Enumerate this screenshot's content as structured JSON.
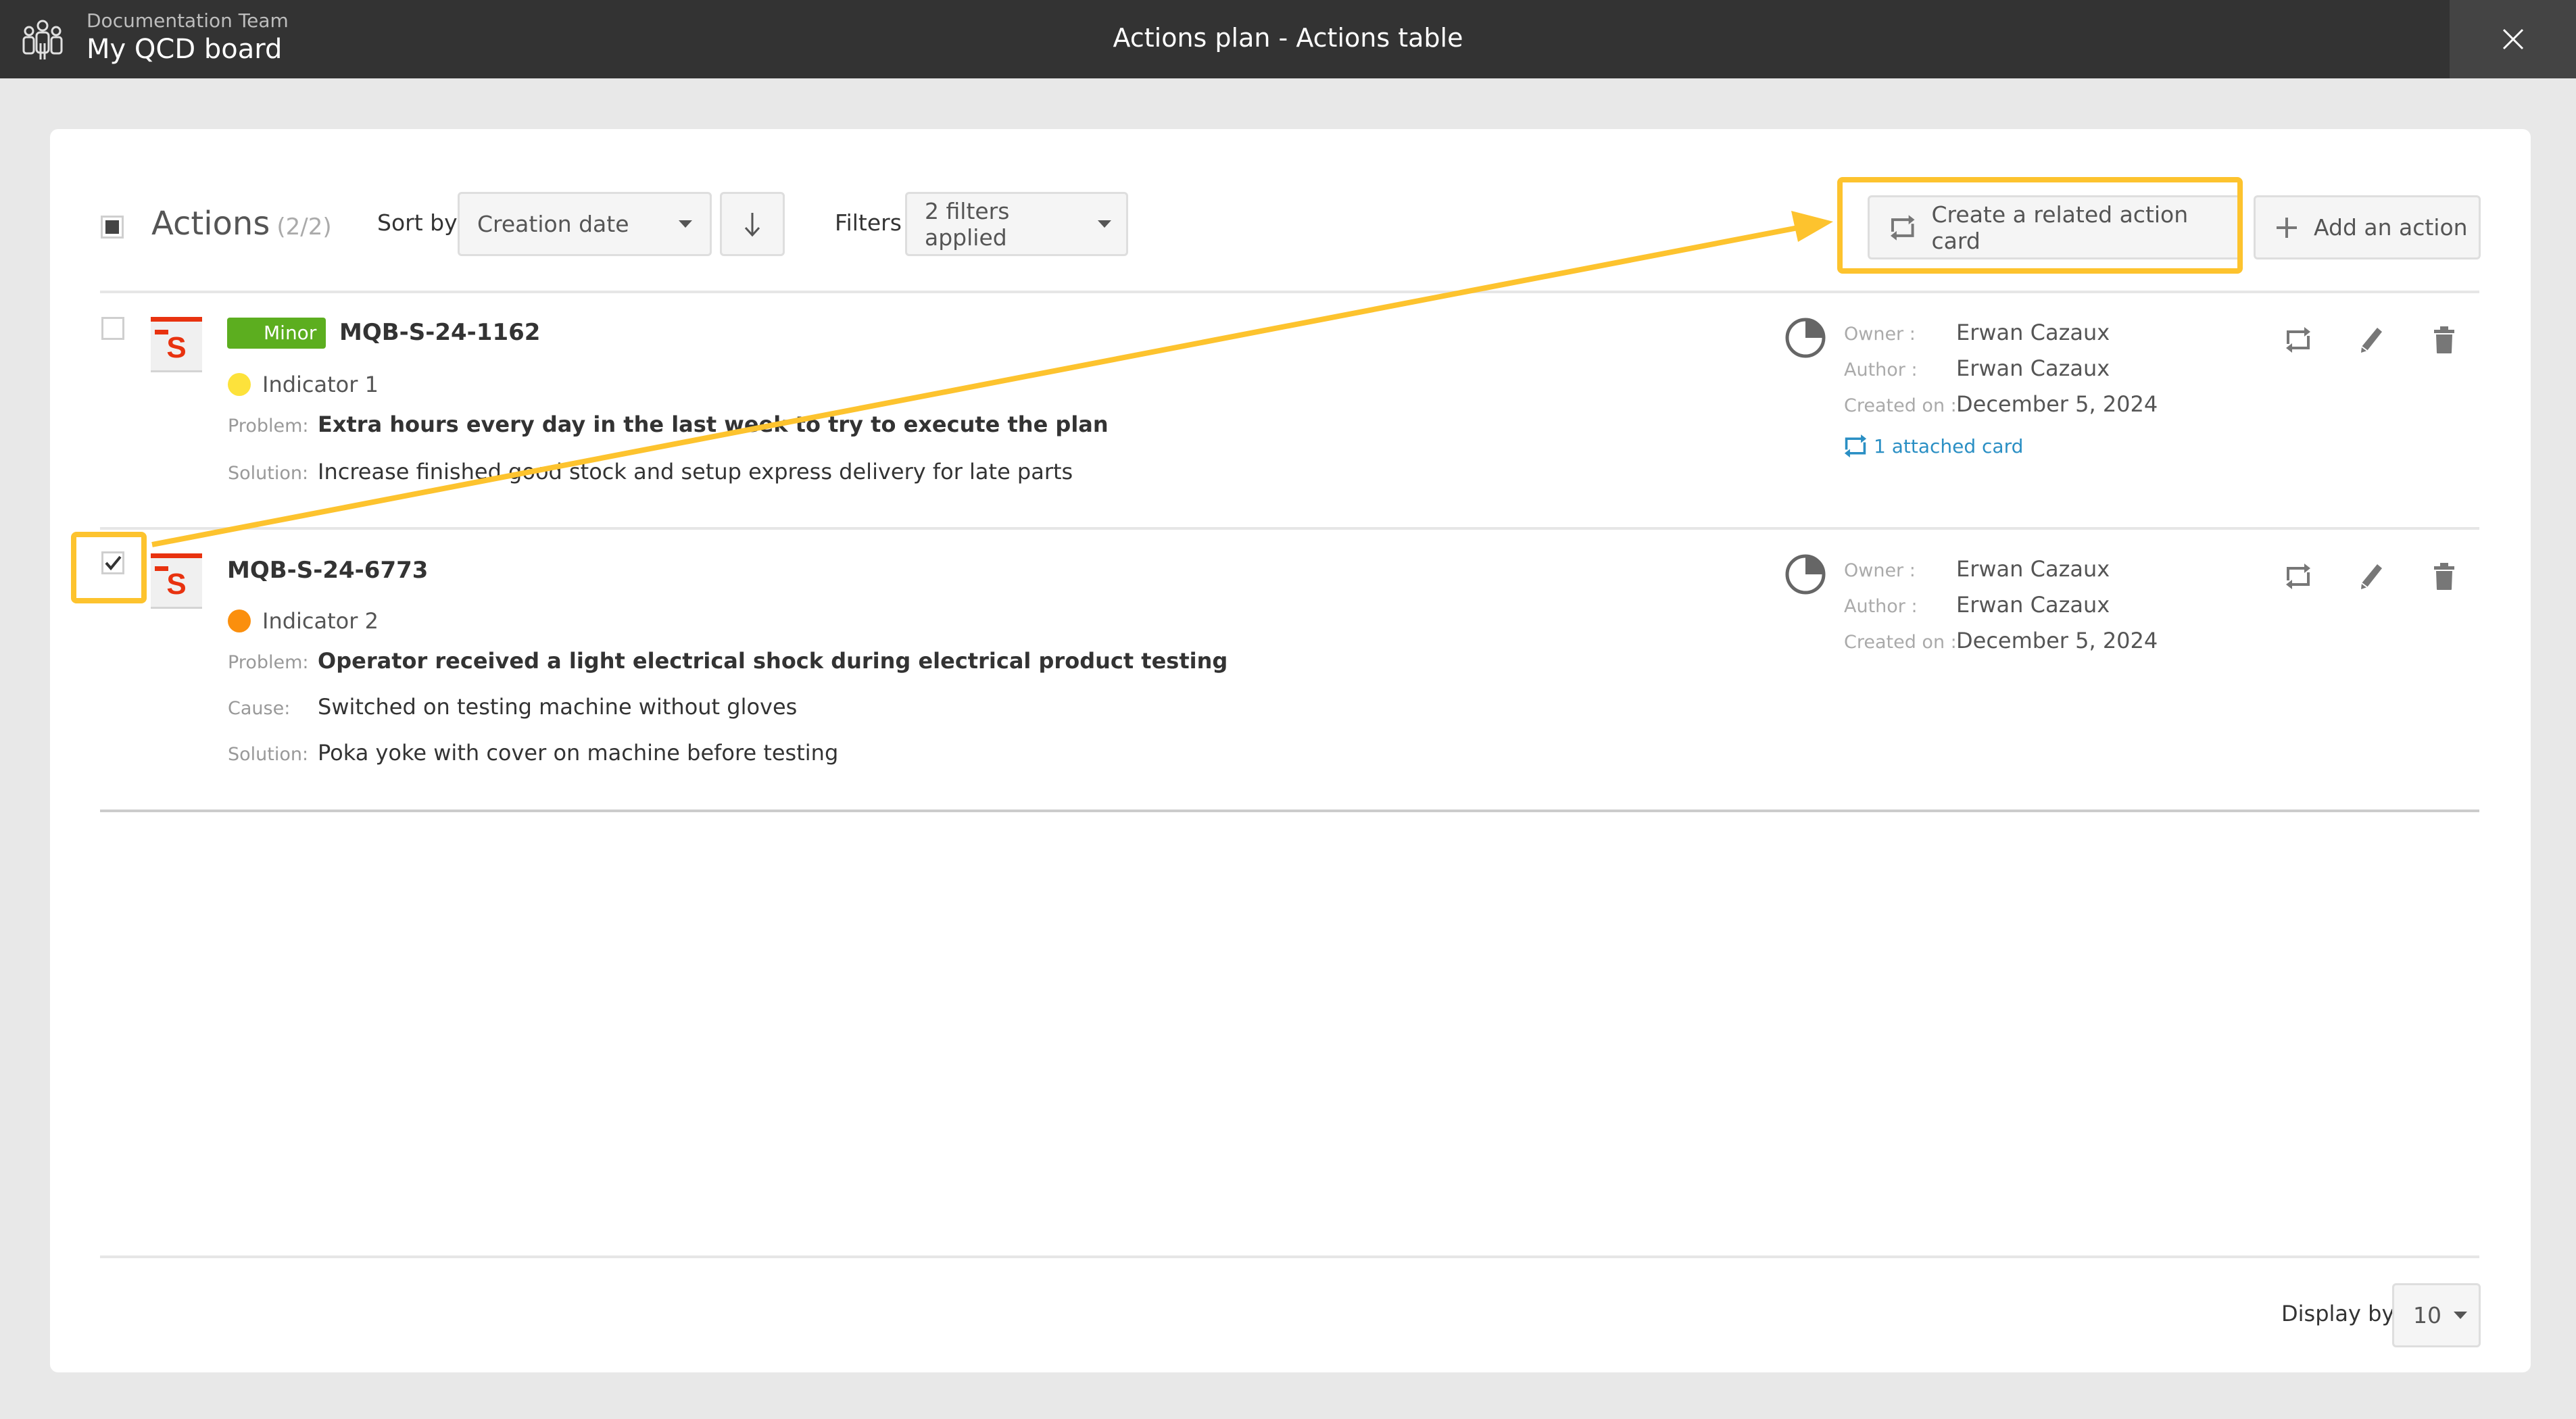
{
  "header": {
    "team_name": "Documentation Team",
    "board_name": "My QCD board",
    "title": "Actions plan - Actions table",
    "team_icon": "team-users-icon",
    "close_icon": "close-icon"
  },
  "toolbar": {
    "title": "Actions",
    "count": "(2/2)",
    "sort_label": "Sort by",
    "sort_value": "Creation date",
    "sort_direction_icon": "arrow-down-icon",
    "filters_label": "Filters",
    "filters_value": "2 filters applied",
    "create_related_label": "Create a related action card",
    "add_action_label": "Add an action"
  },
  "actions": [
    {
      "checked": false,
      "severity": "Minor",
      "code": "MQB-S-24-1162",
      "indicator": {
        "label": "Indicator 1",
        "color": "#fde23b"
      },
      "fields": [
        {
          "label": "Problem:",
          "value": "Extra hours every day in the last week to try to execute the plan",
          "bold": true
        },
        {
          "label": "Solution:",
          "value": "Increase finished good stock and setup express delivery for late parts",
          "bold": false
        }
      ],
      "owner_label": "Owner :",
      "owner": "Erwan Cazaux",
      "author_label": "Author :",
      "author": "Erwan Cazaux",
      "created_label": "Created on :",
      "created": "December 5, 2024",
      "attached": "1 attached card",
      "progress": 0.25
    },
    {
      "checked": true,
      "severity": "",
      "code": "MQB-S-24-6773",
      "indicator": {
        "label": "Indicator 2",
        "color": "#fb8f0d"
      },
      "fields": [
        {
          "label": "Problem:",
          "value": "Operator received a light electrical shock during electrical product testing",
          "bold": true
        },
        {
          "label": "Cause:",
          "value": "Switched on testing machine without gloves",
          "bold": false
        },
        {
          "label": "Solution:",
          "value": "Poka yoke with cover on machine before testing",
          "bold": false
        }
      ],
      "owner_label": "Owner :",
      "owner": "Erwan Cazaux",
      "author_label": "Author :",
      "author": "Erwan Cazaux",
      "created_label": "Created on :",
      "created": "December 5, 2024",
      "attached": "",
      "progress": 0.25
    }
  ],
  "footer": {
    "display_label": "Display by",
    "display_value": "10"
  },
  "colors": {
    "header_bg": "#333333",
    "highlight": "#fdc32e",
    "minor_badge": "#5cae1f",
    "link": "#2a8fc4",
    "s_icon": "#e8320f"
  }
}
